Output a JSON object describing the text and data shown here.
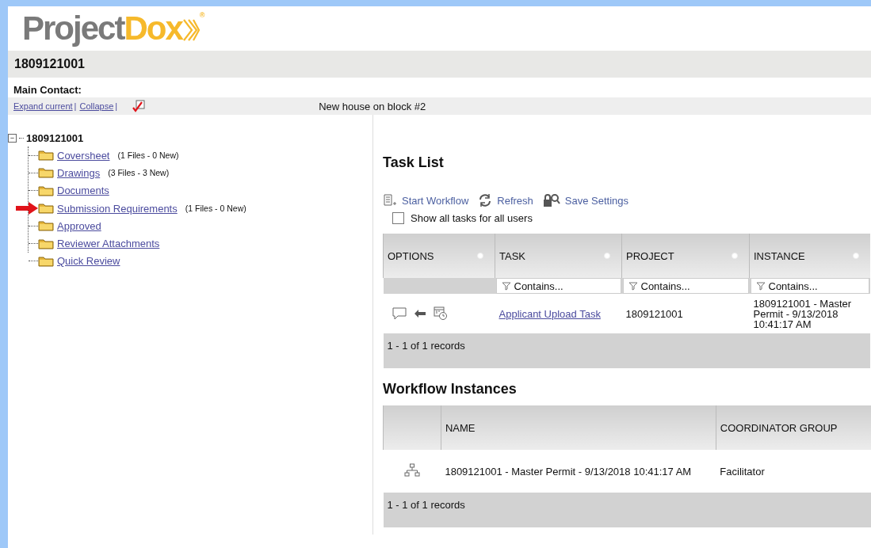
{
  "logo": {
    "part_1": "Project",
    "part_2": "Dox",
    "mark": "®"
  },
  "project": {
    "title": "1809121001",
    "main_contact_label": "Main Contact:"
  },
  "toolbar": {
    "links": [
      "Expand current",
      "Collapse"
    ],
    "separator": "|",
    "checked": true,
    "description": "New house on block #2"
  },
  "tree": {
    "label": "1809121001",
    "toggle": "−",
    "children": [
      {
        "label": "Coversheet",
        "count": "(1 Files - 0 New)",
        "pointed": false
      },
      {
        "label": "Drawings",
        "count": "(3 Files - 3 New)",
        "pointed": false
      },
      {
        "label": "Documents",
        "pointed": false
      },
      {
        "label": "Submission Requirements",
        "count": "(1 Files - 0 New)",
        "pointed": true
      },
      {
        "label": "Approved",
        "pointed": false
      },
      {
        "label": "Reviewer Attachments",
        "pointed": false
      },
      {
        "label": "Quick Review",
        "pointed": false
      }
    ]
  },
  "task_list": {
    "title": "Task List",
    "actions": [
      {
        "kind": "start",
        "label": "Start Workflow"
      },
      {
        "kind": "refresh",
        "label": "Refresh"
      },
      {
        "kind": "save",
        "label": "Save Settings"
      }
    ],
    "show_all": {
      "label": "Show all tasks for all users",
      "checked": false
    },
    "columns": [
      "OPTIONS",
      "TASK",
      "PROJECT",
      "INSTANCE"
    ],
    "filter_placeholders": [
      "Contains...",
      "Contains...",
      "Contains..."
    ],
    "rows": [
      {
        "task": "Applicant Upload Task",
        "project": "1809121001",
        "instance": "1809121001 - Master Permit - 9/13/2018 10:41:17 AM"
      }
    ],
    "footer": "1 - 1 of 1 records"
  },
  "workflow_instances": {
    "title": "Workflow Instances",
    "columns": [
      "NAME",
      "COORDINATOR GROUP"
    ],
    "rows": [
      {
        "name": "1809121001 - Master Permit - 9/13/2018 10:41:17 AM",
        "coordinator_group": "Facilitator"
      }
    ],
    "footer": "1 - 1 of 1 records"
  }
}
